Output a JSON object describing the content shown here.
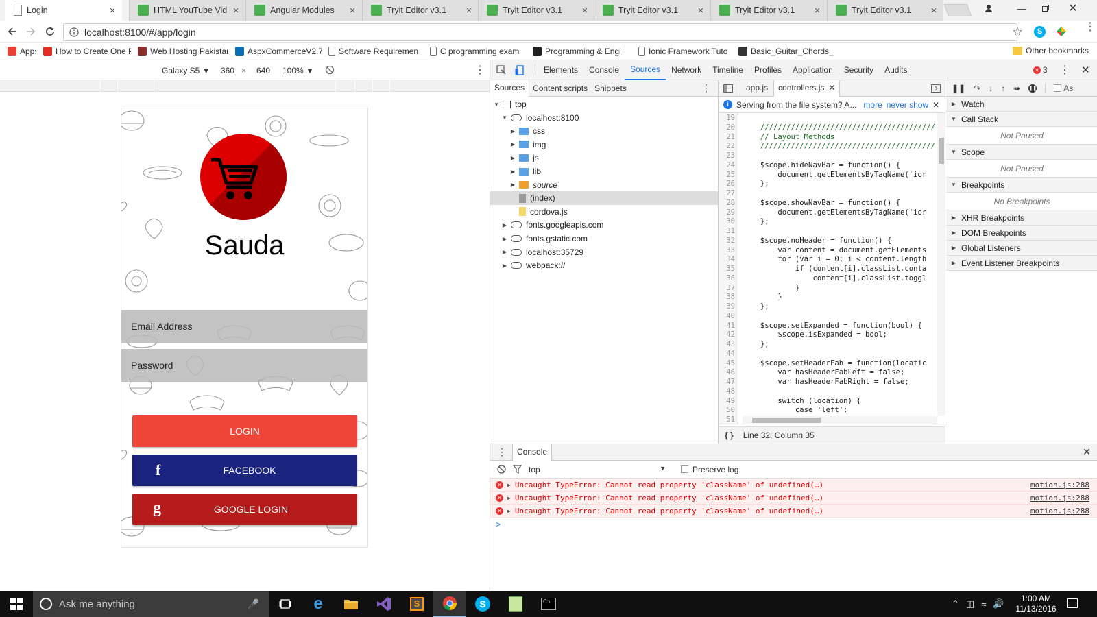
{
  "browser": {
    "tabs": [
      {
        "label": "Login",
        "icon": "page-icon",
        "active": true
      },
      {
        "label": "HTML YouTube Vide",
        "icon": "w3-icon"
      },
      {
        "label": "Angular Modules",
        "icon": "w3-icon"
      },
      {
        "label": "Tryit Editor v3.1",
        "icon": "w3-icon"
      },
      {
        "label": "Tryit Editor v3.1",
        "icon": "w3-icon"
      },
      {
        "label": "Tryit Editor v3.1",
        "icon": "w3-icon"
      },
      {
        "label": "Tryit Editor v3.1",
        "icon": "w3-icon"
      },
      {
        "label": "Tryit Editor v3.1",
        "icon": "w3-icon"
      }
    ],
    "url": "localhost:8100/#/app/login",
    "bookmarks": [
      {
        "label": "Apps",
        "icon": "apps-grid-icon"
      },
      {
        "label": "How to Create One Pa",
        "icon": "youtube-icon"
      },
      {
        "label": "Web Hosting Pakistan",
        "icon": "host-icon"
      },
      {
        "label": "AspxCommerceV2.7_",
        "icon": "aspx-icon"
      },
      {
        "label": "Software Requiremen",
        "icon": "page-icon"
      },
      {
        "label": "C programming exam",
        "icon": "page-icon"
      },
      {
        "label": "Programming & Engi",
        "icon": "sf-icon"
      },
      {
        "label": "Ionic Framework Tuto",
        "icon": "page-icon"
      },
      {
        "label": "Basic_Guitar_Chords_",
        "icon": "guitar-icon"
      }
    ],
    "other_bookmarks": "Other bookmarks"
  },
  "device_toolbar": {
    "device": "Galaxy S5",
    "width": "360",
    "times": "×",
    "height": "640",
    "zoom": "100%"
  },
  "app": {
    "title": "Sauda",
    "email_placeholder": "Email Address",
    "password_placeholder": "Password",
    "login_label": "LOGIN",
    "facebook_label": "FACEBOOK",
    "google_label": "GOOGLE LOGIN",
    "colors": {
      "login": "#ef4438",
      "facebook": "#1a237e",
      "google": "#b71c1c",
      "logo": "#dd0000"
    }
  },
  "devtools": {
    "tabs": [
      "Elements",
      "Console",
      "Sources",
      "Network",
      "Timeline",
      "Profiles",
      "Application",
      "Security",
      "Audits"
    ],
    "selected_tab": "Sources",
    "error_count": "3",
    "navigator_tabs": [
      "Sources",
      "Content scripts",
      "Snippets"
    ],
    "tree": [
      {
        "label": "top",
        "indent": 0,
        "arrow": "down",
        "icon": "frame-icon"
      },
      {
        "label": "localhost:8100",
        "indent": 1,
        "arrow": "down",
        "icon": "cloud-icon"
      },
      {
        "label": "css",
        "indent": 2,
        "arrow": "right",
        "icon": "folder-icon"
      },
      {
        "label": "img",
        "indent": 2,
        "arrow": "right",
        "icon": "folder-icon"
      },
      {
        "label": "js",
        "indent": 2,
        "arrow": "right",
        "icon": "folder-icon"
      },
      {
        "label": "lib",
        "indent": 2,
        "arrow": "right",
        "icon": "folder-icon"
      },
      {
        "label": "source",
        "indent": 2,
        "arrow": "right",
        "icon": "folder-orange-icon",
        "italic": true
      },
      {
        "label": "(index)",
        "indent": 2,
        "arrow": "",
        "icon": "file-gray-icon",
        "selected": true
      },
      {
        "label": "cordova.js",
        "indent": 2,
        "arrow": "",
        "icon": "file-yellow-icon"
      },
      {
        "label": "fonts.googleapis.com",
        "indent": 1,
        "arrow": "right",
        "icon": "cloud-icon"
      },
      {
        "label": "fonts.gstatic.com",
        "indent": 1,
        "arrow": "right",
        "icon": "cloud-icon"
      },
      {
        "label": "localhost:35729",
        "indent": 1,
        "arrow": "right",
        "icon": "cloud-icon"
      },
      {
        "label": "webpack://",
        "indent": 1,
        "arrow": "right",
        "icon": "cloud-icon"
      }
    ],
    "editor_tabs": [
      "app.js",
      "controllers.js"
    ],
    "active_editor_tab": "controllers.js",
    "info_text": "Serving from the file system? A...",
    "info_more": "more",
    "info_never": "never show",
    "code_lines": [
      {
        "n": "19",
        "t": ""
      },
      {
        "n": "20",
        "t": "    ////////////////////////////////////////",
        "c": true
      },
      {
        "n": "21",
        "t": "    // Layout Methods",
        "c": true
      },
      {
        "n": "22",
        "t": "    ////////////////////////////////////////",
        "c": true
      },
      {
        "n": "23",
        "t": ""
      },
      {
        "n": "24",
        "t": "    $scope.hideNavBar = function() {"
      },
      {
        "n": "25",
        "t": "        document.getElementsByTagName('ior"
      },
      {
        "n": "26",
        "t": "    };"
      },
      {
        "n": "27",
        "t": ""
      },
      {
        "n": "28",
        "t": "    $scope.showNavBar = function() {"
      },
      {
        "n": "29",
        "t": "        document.getElementsByTagName('ior"
      },
      {
        "n": "30",
        "t": "    };"
      },
      {
        "n": "31",
        "t": ""
      },
      {
        "n": "32",
        "t": "    $scope.noHeader = function() {"
      },
      {
        "n": "33",
        "t": "        var content = document.getElements"
      },
      {
        "n": "34",
        "t": "        for (var i = 0; i < content.length"
      },
      {
        "n": "35",
        "t": "            if (content[i].classList.conta"
      },
      {
        "n": "36",
        "t": "                content[i].classList.toggl"
      },
      {
        "n": "37",
        "t": "            }"
      },
      {
        "n": "38",
        "t": "        }"
      },
      {
        "n": "39",
        "t": "    };"
      },
      {
        "n": "40",
        "t": ""
      },
      {
        "n": "41",
        "t": "    $scope.setExpanded = function(bool) {"
      },
      {
        "n": "42",
        "t": "        $scope.isExpanded = bool;"
      },
      {
        "n": "43",
        "t": "    };"
      },
      {
        "n": "44",
        "t": ""
      },
      {
        "n": "45",
        "t": "    $scope.setHeaderFab = function(locatic"
      },
      {
        "n": "46",
        "t": "        var hasHeaderFabLeft = false;"
      },
      {
        "n": "47",
        "t": "        var hasHeaderFabRight = false;"
      },
      {
        "n": "48",
        "t": ""
      },
      {
        "n": "49",
        "t": "        switch (location) {"
      },
      {
        "n": "50",
        "t": "            case 'left':"
      },
      {
        "n": "51",
        "t": ""
      }
    ],
    "status": "Line 32, Column 35",
    "debugger": {
      "watch": "Watch",
      "call_stack": "Call Stack",
      "not_paused": "Not Paused",
      "scope": "Scope",
      "scope_not_paused": "Not Paused",
      "breakpoints": "Breakpoints",
      "no_breakpoints": "No Breakpoints",
      "xhr": "XHR Breakpoints",
      "dom": "DOM Breakpoints",
      "global": "Global Listeners",
      "event": "Event Listener Breakpoints",
      "async_label": "As"
    },
    "console": {
      "title": "Console",
      "context": "top",
      "preserve_log": "Preserve log",
      "errors": [
        {
          "msg": "Uncaught TypeError: Cannot read property 'className' of undefined(…)",
          "src": "motion.js:288"
        },
        {
          "msg": "Uncaught TypeError: Cannot read property 'className' of undefined(…)",
          "src": "motion.js:288"
        },
        {
          "msg": "Uncaught TypeError: Cannot read property 'className' of undefined(…)",
          "src": "motion.js:288"
        }
      ]
    }
  },
  "taskbar": {
    "search": "Ask me anything",
    "time": "1:00 AM",
    "date": "11/13/2016"
  }
}
